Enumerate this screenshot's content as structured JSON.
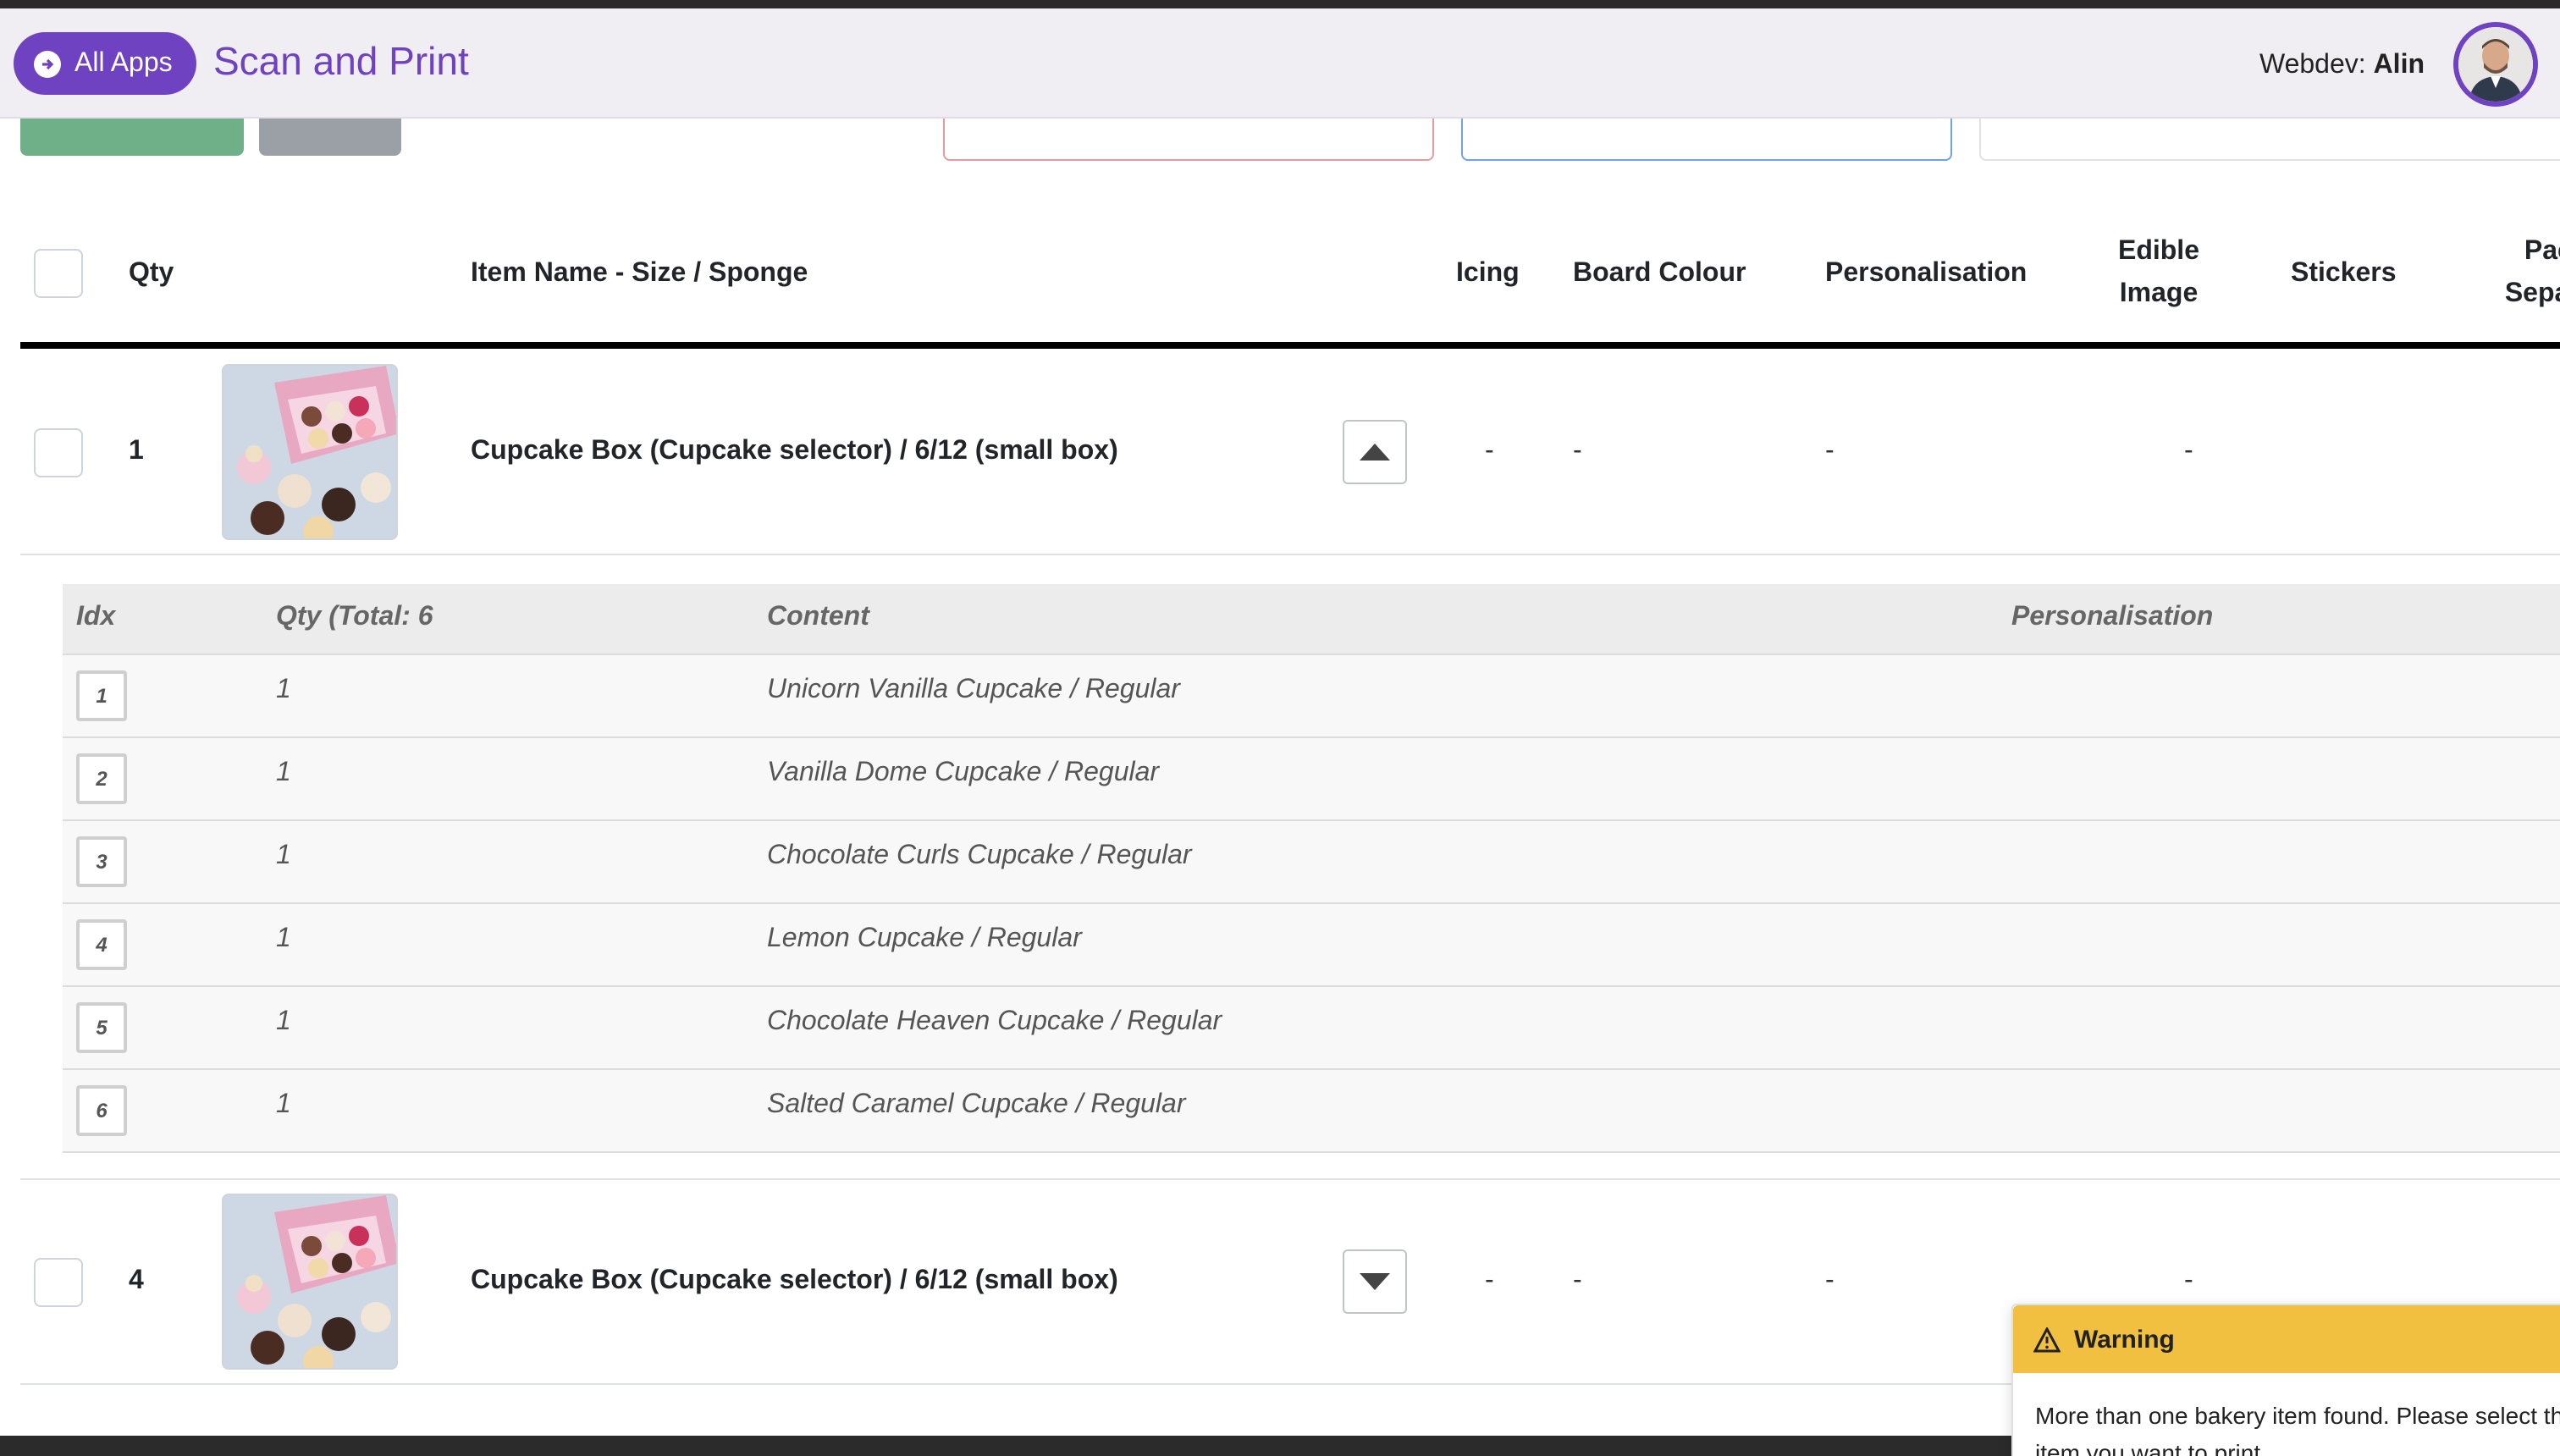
{
  "header": {
    "all_apps_label": "All Apps",
    "app_title": "Scan and Print",
    "user_prefix": "Webdev:",
    "user_name": "Alin"
  },
  "table": {
    "columns": {
      "qty": "Qty",
      "item_name": "Item Name - Size / Sponge",
      "icing": "Icing",
      "board_colour": "Board Colour",
      "personalisation": "Personalisation",
      "edible_image_1": "Edible",
      "edible_image_2": "Image",
      "stickers": "Stickers",
      "packed_separate_1": "Packed",
      "packed_separate_2": "Separate"
    },
    "rows": [
      {
        "qty": "1",
        "name": "Cupcake Box (Cupcake selector) / 6/12 (small box)",
        "icing": "-",
        "board_colour": "-",
        "personalisation": "-",
        "edible_image": "-",
        "expanded": true,
        "packed_separate": false
      },
      {
        "qty": "4",
        "name": "Cupcake Box (Cupcake selector) / 6/12 (small box)",
        "icing": "-",
        "board_colour": "-",
        "personalisation": "-",
        "edible_image": "-",
        "expanded": false,
        "packed_separate": true
      }
    ],
    "subtable": {
      "columns": {
        "idx": "Idx",
        "qty": "Qty (Total: 6",
        "content": "Content",
        "personalisation": "Personalisation"
      },
      "rows": [
        {
          "idx": "1",
          "qty": "1",
          "content": "Unicorn Vanilla Cupcake / Regular"
        },
        {
          "idx": "2",
          "qty": "1",
          "content": "Vanilla Dome Cupcake / Regular"
        },
        {
          "idx": "3",
          "qty": "1",
          "content": "Chocolate Curls Cupcake / Regular"
        },
        {
          "idx": "4",
          "qty": "1",
          "content": "Lemon Cupcake / Regular"
        },
        {
          "idx": "5",
          "qty": "1",
          "content": "Chocolate Heaven Cupcake / Regular"
        },
        {
          "idx": "6",
          "qty": "1",
          "content": "Salted Caramel Cupcake / Regular"
        }
      ]
    }
  },
  "toast": {
    "title": "Warning",
    "message": "More than one bakery item found. Please select the item you want to print."
  },
  "colors": {
    "brand": "#6f42c1",
    "warning": "#f1c041",
    "success": "#3a9b5a"
  }
}
